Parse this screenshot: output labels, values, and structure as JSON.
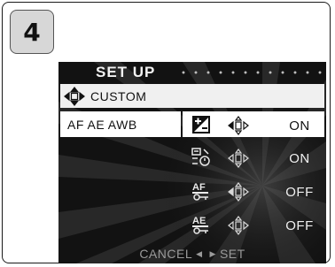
{
  "step_number": "4",
  "menu": {
    "title": "SET UP",
    "custom_label": "CUSTOM",
    "tab_label": "AF AE AWB",
    "options": [
      {
        "icon": "exposure-compensation-icon",
        "value": "ON"
      },
      {
        "icon": "white-balance-icon",
        "value": "ON"
      },
      {
        "icon": "af-lock-icon",
        "value": "OFF"
      },
      {
        "icon": "ae-lock-icon",
        "value": "OFF"
      }
    ],
    "cancel_label": "CANCEL",
    "set_label": "SET"
  },
  "colors": {
    "screen_bg": "#121212",
    "highlight": "#ffffff",
    "hint_text": "#9a9a9a"
  }
}
